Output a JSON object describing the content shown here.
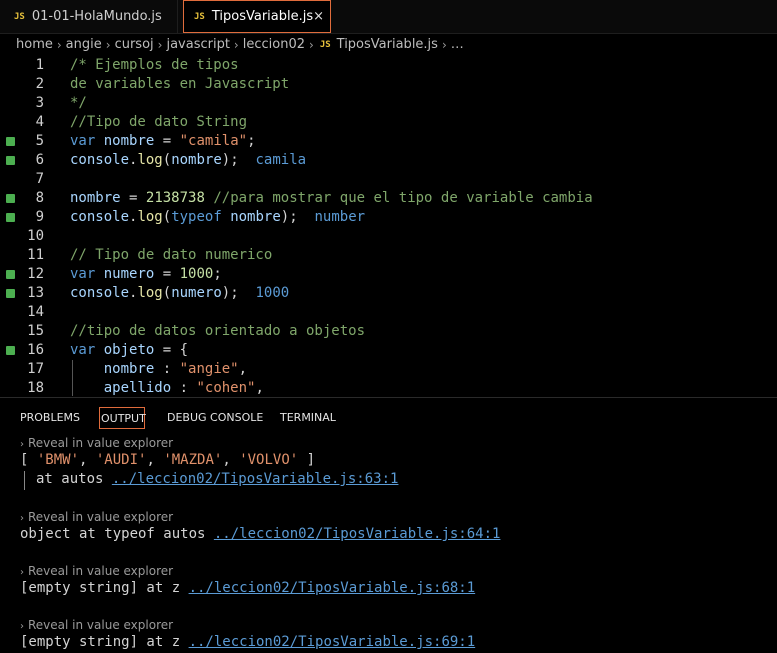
{
  "tabs": [
    {
      "icon": "JS",
      "label": "01-01-HolaMundo.js"
    },
    {
      "icon": "JS",
      "label": "TiposVariable.js",
      "close": "×"
    }
  ],
  "breadcrumb": [
    "home",
    "angie",
    "cursoj",
    "javascript",
    "leccion02",
    "TiposVariable.js",
    "…"
  ],
  "breadcrumb_sep": "›",
  "editor": {
    "lines": [
      {
        "n": "1",
        "text": "/* Ejemplos de tipos"
      },
      {
        "n": "2",
        "text": "de variables en Javascript"
      },
      {
        "n": "3",
        "text": "*/"
      },
      {
        "n": "4",
        "text": "//Tipo de dato String"
      },
      {
        "n": "5",
        "text": "var nombre = \"camila\";"
      },
      {
        "n": "6",
        "text": "console.log(nombre);",
        "inline": "camila"
      },
      {
        "n": "7",
        "text": ""
      },
      {
        "n": "8",
        "text": "nombre = 2138738 //para mostrar que el tipo de variable cambia"
      },
      {
        "n": "9",
        "text": "console.log(typeof nombre);",
        "inline": "number"
      },
      {
        "n": "10",
        "text": ""
      },
      {
        "n": "11",
        "text": "// Tipo de dato numerico"
      },
      {
        "n": "12",
        "text": "var numero = 1000;"
      },
      {
        "n": "13",
        "text": "console.log(numero);",
        "inline": "1000"
      },
      {
        "n": "14",
        "text": ""
      },
      {
        "n": "15",
        "text": "//tipo de datos orientado a objetos"
      },
      {
        "n": "16",
        "text": "var objeto = {"
      },
      {
        "n": "17",
        "text": "    nombre : \"angie\","
      },
      {
        "n": "18",
        "text": "    apellido : \"cohen\","
      }
    ]
  },
  "panel": {
    "tabs": [
      "PROBLEMS",
      "OUTPUT",
      "DEBUG CONSOLE",
      "TERMINAL"
    ],
    "active_tab": "OUTPUT",
    "hint": "Reveal in value explorer",
    "entries": [
      {
        "value": "[ 'BMW', 'AUDI', 'MAZDA', 'VOLVO' ]",
        "sub": "at autos",
        "link": "../leccion02/TiposVariable.js:63:1"
      },
      {
        "value": "object at typeof autos",
        "link": "../leccion02/TiposVariable.js:64:1"
      },
      {
        "value": "[empty string] at z",
        "link": "../leccion02/TiposVariable.js:68:1"
      },
      {
        "value": "[empty string] at z",
        "link": "../leccion02/TiposVariable.js:69:1"
      }
    ]
  },
  "colors": {
    "accent": "#e06c3c",
    "gutter_marker": "#4caf50",
    "js_icon": "#e8c23c"
  }
}
